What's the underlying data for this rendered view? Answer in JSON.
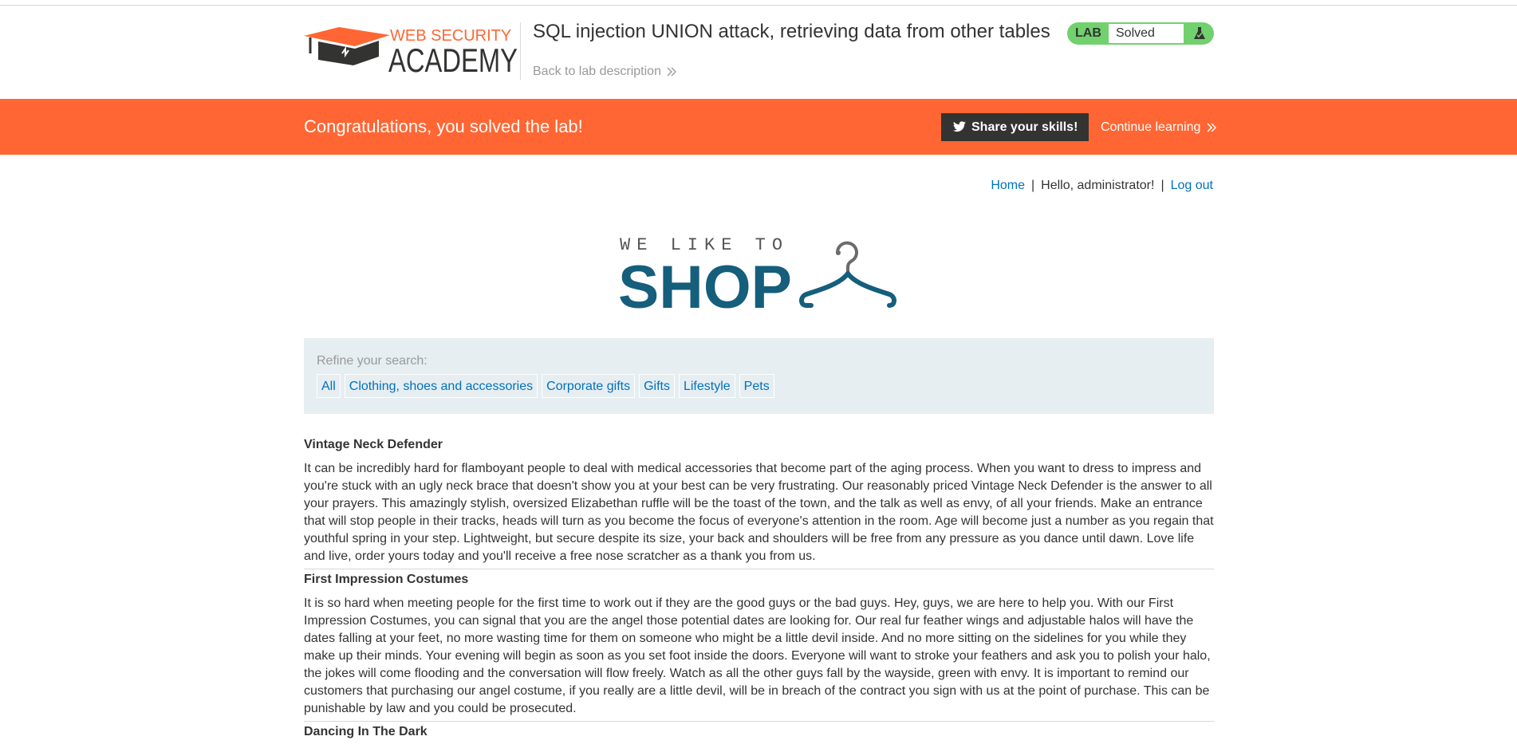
{
  "academy": {
    "logo_top": "WEB SECURITY",
    "logo_bottom": "ACADEMY",
    "lab_title": "SQL injection UNION attack, retrieving data from other tables",
    "back_link": "Back to lab description",
    "lab_badge": "LAB",
    "lab_state": "Solved",
    "brand_color": "#ff6633",
    "solved_color": "#70d16d"
  },
  "banner": {
    "message": "Congratulations, you solved the lab!",
    "share_label": "Share your skills!",
    "continue_label": "Continue learning"
  },
  "account": {
    "home": "Home",
    "hello": "Hello, administrator!",
    "logout": "Log out"
  },
  "shop": {
    "tagline": "WE LIKE TO",
    "name": "SHOP",
    "accent_color": "#155e7c"
  },
  "filter": {
    "label": "Refine your search:",
    "categories": [
      "All",
      "Clothing, shoes and accessories",
      "Corporate gifts",
      "Gifts",
      "Lifestyle",
      "Pets"
    ]
  },
  "products": [
    {
      "name": "Vintage Neck Defender",
      "description": "It can be incredibly hard for flamboyant people to deal with medical accessories that become part of the aging process. When you want to dress to impress and you're stuck with an ugly neck brace that doesn't show you at your best can be very frustrating. Our reasonably priced Vintage Neck Defender is the answer to all your prayers. This amazingly stylish, oversized Elizabethan ruffle will be the toast of the town, and the talk as well as envy, of all your friends. Make an entrance that will stop people in their tracks, heads will turn as you become the focus of everyone's attention in the room. Age will become just a number as you regain that youthful spring in your step. Lightweight, but secure despite its size, your back and shoulders will be free from any pressure as you dance until dawn. Love life and live, order yours today and you'll receive a free nose scratcher as a thank you from us."
    },
    {
      "name": "First Impression Costumes",
      "description": "It is so hard when meeting people for the first time to work out if they are the good guys or the bad guys. Hey, guys, we are here to help you. With our First Impression Costumes, you can signal that you are the angel those potential dates are looking for. Our real fur feather wings and adjustable halos will have the dates falling at your feet, no more wasting time for them on someone who might be a little devil inside. And no more sitting on the sidelines for you while they make up their minds. Your evening will begin as soon as you set foot inside the doors. Everyone will want to stroke your feathers and ask you to polish your halo, the jokes will come flooding and the conversation will flow freely. Watch as all the other guys fall by the wayside, green with envy. It is important to remind our customers that purchasing our angel costume, if you really are a little devil, will be in breach of the contract you sign with us at the point of purchase. This can be punishable by law and you could be prosecuted."
    },
    {
      "name": "Dancing In The Dark",
      "description": ""
    }
  ]
}
